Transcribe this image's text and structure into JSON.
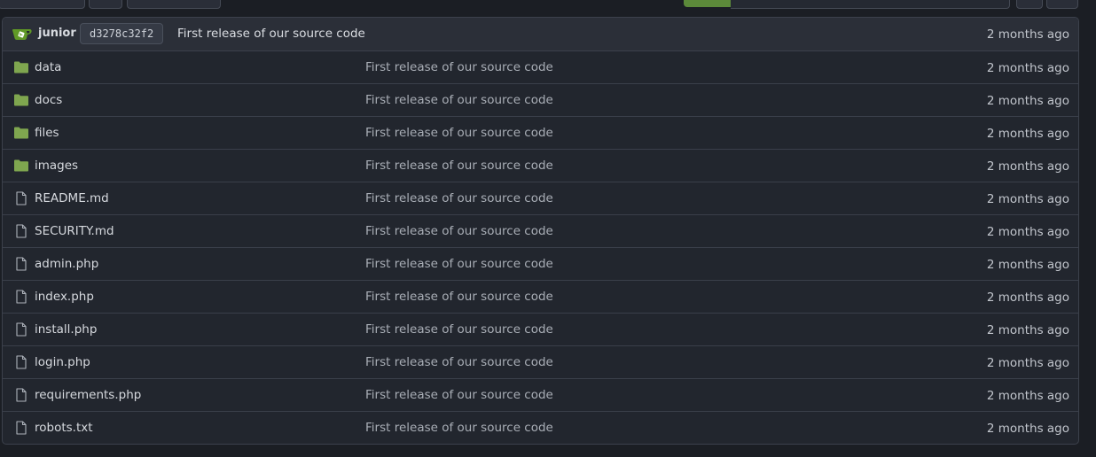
{
  "latest_commit": {
    "author": "junior",
    "sha": "d3278c32f2",
    "message": "First release of our source code",
    "time": "2 months ago"
  },
  "colors": {
    "folder": "#7fa64f",
    "avatar": "#609926"
  },
  "entries": [
    {
      "name": "data",
      "type": "folder",
      "message": "First release of our source code",
      "time": "2 months ago"
    },
    {
      "name": "docs",
      "type": "folder",
      "message": "First release of our source code",
      "time": "2 months ago"
    },
    {
      "name": "files",
      "type": "folder",
      "message": "First release of our source code",
      "time": "2 months ago"
    },
    {
      "name": "images",
      "type": "folder",
      "message": "First release of our source code",
      "time": "2 months ago"
    },
    {
      "name": "README.md",
      "type": "file",
      "message": "First release of our source code",
      "time": "2 months ago"
    },
    {
      "name": "SECURITY.md",
      "type": "file",
      "message": "First release of our source code",
      "time": "2 months ago"
    },
    {
      "name": "admin.php",
      "type": "file",
      "message": "First release of our source code",
      "time": "2 months ago"
    },
    {
      "name": "index.php",
      "type": "file",
      "message": "First release of our source code",
      "time": "2 months ago"
    },
    {
      "name": "install.php",
      "type": "file",
      "message": "First release of our source code",
      "time": "2 months ago"
    },
    {
      "name": "login.php",
      "type": "file",
      "message": "First release of our source code",
      "time": "2 months ago"
    },
    {
      "name": "requirements.php",
      "type": "file",
      "message": "First release of our source code",
      "time": "2 months ago"
    },
    {
      "name": "robots.txt",
      "type": "file",
      "message": "First release of our source code",
      "time": "2 months ago"
    }
  ]
}
